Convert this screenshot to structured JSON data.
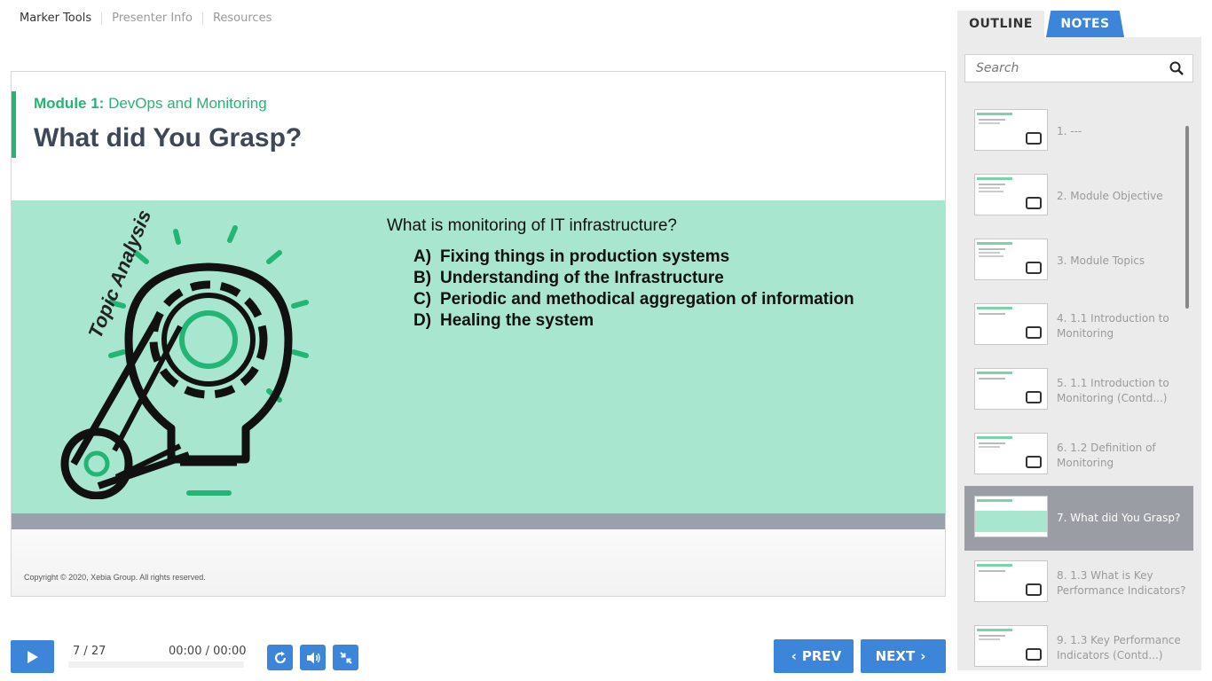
{
  "topnav": {
    "items": [
      "Marker Tools",
      "Presenter Info",
      "Resources"
    ]
  },
  "slide": {
    "module_prefix": "Module 1:",
    "module_name": "DevOps and Monitoring",
    "title": "What did You Grasp?",
    "art_label": "Topic Analysis",
    "question": "What is monitoring of IT infrastructure?",
    "options": [
      {
        "letter": "A)",
        "text": "Fixing things in production systems"
      },
      {
        "letter": "B)",
        "text": "Understanding of the Infrastructure"
      },
      {
        "letter": "C)",
        "text": "Periodic and methodical aggregation of information"
      },
      {
        "letter": "D)",
        "text": "Healing the system"
      }
    ],
    "copyright": "Copyright © 2020, Xebia Group. All rights reserved."
  },
  "player": {
    "counter": "7 / 27",
    "time": "00:00 / 00:00",
    "prev_label": "PREV",
    "next_label": "NEXT"
  },
  "sidebar": {
    "tabs": [
      "OUTLINE",
      "NOTES"
    ],
    "active_tab": "NOTES",
    "search_placeholder": "Search",
    "slides": [
      {
        "label": "1. ---"
      },
      {
        "label": "2. Module Objective"
      },
      {
        "label": "3. Module Topics"
      },
      {
        "label": "4. 1.1 Introduction to Monitoring"
      },
      {
        "label": "5. 1.1 Introduction to Monitoring (Contd...)"
      },
      {
        "label": "6. 1.2 Definition of Monitoring"
      },
      {
        "label": "7. What did You Grasp?"
      },
      {
        "label": "8. 1.3 What is Key Performance Indicators?"
      },
      {
        "label": "9. 1.3 Key Performance Indicators (Contd...)"
      }
    ],
    "active_index": 6
  },
  "colors": {
    "accent_blue": "#3d85d8",
    "accent_green": "#22b573",
    "panel_green": "#a8e6cf"
  }
}
